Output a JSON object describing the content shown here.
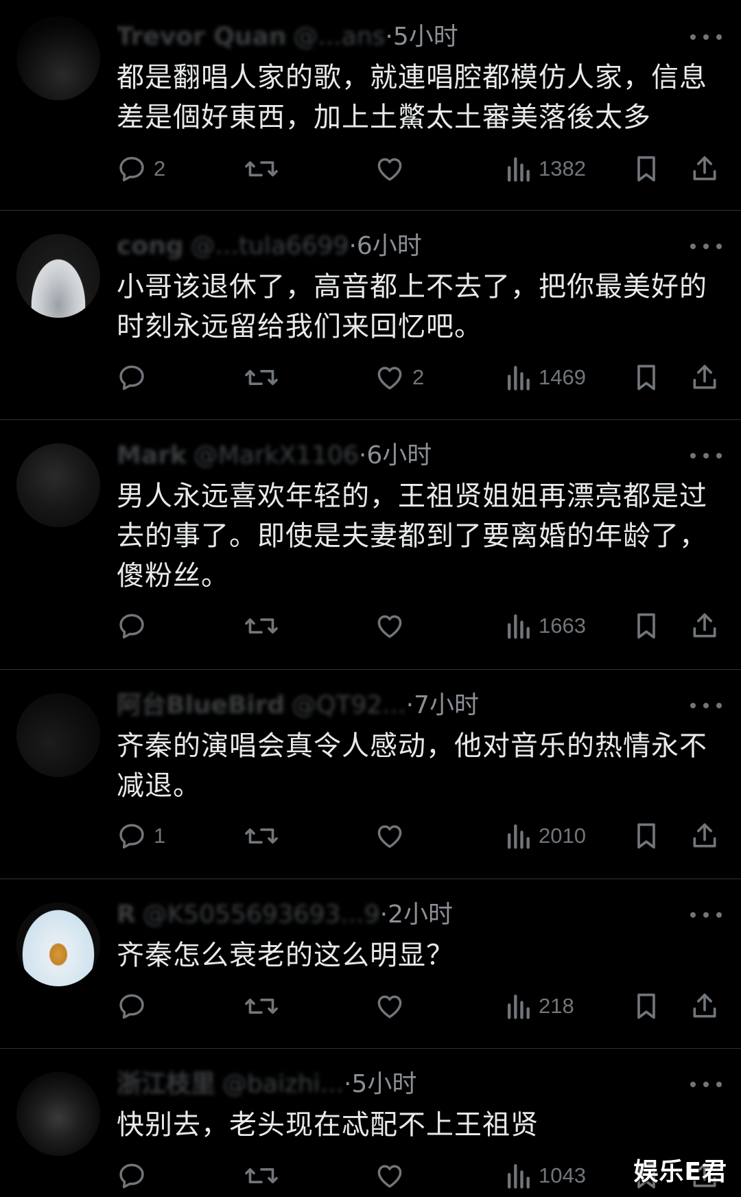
{
  "tweets": [
    {
      "name": "Trevor Quan",
      "handle": "@...ans",
      "time": "·5小时",
      "text": "都是翻唱人家的歌，就連唱腔都模仿人家，信息差是個好東西，加上土鱉太土審美落後太多",
      "replies": "2",
      "likes": "",
      "views": "1382"
    },
    {
      "name": "cong",
      "handle": "@...tula6699",
      "time": "·6小时",
      "text": "小哥该退休了，高音都上不去了，把你最美好的时刻永远留给我们来回忆吧。",
      "replies": "",
      "likes": "2",
      "views": "1469"
    },
    {
      "name": "Mark",
      "handle": "@MarkX1106",
      "time": "·6小时",
      "text": "男人永远喜欢年轻的，王祖贤姐姐再漂亮都是过去的事了。即使是夫妻都到了要离婚的年龄了，傻粉丝。",
      "replies": "",
      "likes": "",
      "views": "1663"
    },
    {
      "name": "阿台BlueBird",
      "handle": "@QT92...",
      "time": "·7小时",
      "text": "齐秦的演唱会真令人感动，他对音乐的热情永不减退。",
      "replies": "1",
      "likes": "",
      "views": "2010"
    },
    {
      "name": "R",
      "handle": "@K5055693693...9",
      "time": "·2小时",
      "text": "齐秦怎么衰老的这么明显？",
      "replies": "",
      "likes": "",
      "views": "218"
    },
    {
      "name": "浙江枝里",
      "handle": "@baizhi...",
      "time": "·5小时",
      "text": "快别去，老头现在忒配不上王祖贤",
      "replies": "",
      "likes": "",
      "views": "1043"
    }
  ],
  "watermark": "娱乐E君"
}
